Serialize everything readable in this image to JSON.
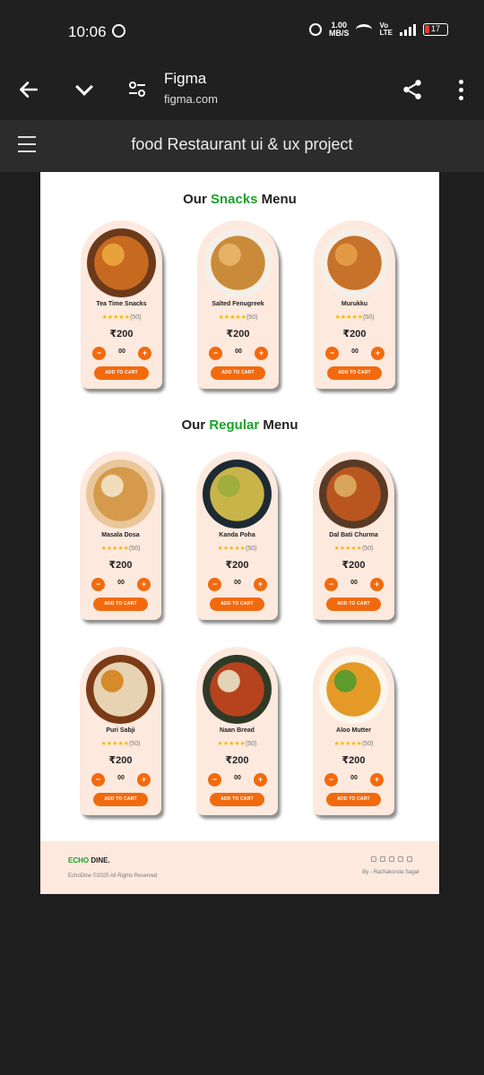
{
  "status_bar": {
    "time": "10:06",
    "speed_value": "1.00",
    "speed_unit": "MB/S",
    "volte_top": "Vo",
    "volte_bottom": "LTE",
    "battery": "17"
  },
  "browser": {
    "site_title": "Figma",
    "site_url": "figma.com"
  },
  "figma": {
    "title": "food Restaurant ui & ux project"
  },
  "sections": {
    "snacks": {
      "prefix": "Our ",
      "accent": "Snacks",
      "suffix": " Menu"
    },
    "regular": {
      "prefix": "Our ",
      "accent": "Regular",
      "suffix": " Menu"
    }
  },
  "items": [
    {
      "name": "Tea Time Snacks",
      "stars": "★★★★★",
      "count": "(50)",
      "price": "₹200",
      "qty": "00",
      "cart": "ADD TO CART",
      "minus": "−",
      "plus": "+",
      "colors": [
        "#6b3a1a",
        "#c76a1f",
        "#e9a23b"
      ]
    },
    {
      "name": "Salted Fenugreek",
      "stars": "★★★★★",
      "count": "(50)",
      "price": "₹200",
      "qty": "00",
      "cart": "ADD TO CART",
      "minus": "−",
      "plus": "+",
      "colors": [
        "#f5efe7",
        "#c98b3a",
        "#e7b266"
      ]
    },
    {
      "name": "Murukku",
      "stars": "★★★★★",
      "count": "(50)",
      "price": "₹200",
      "qty": "00",
      "cart": "ADD TO CART",
      "minus": "−",
      "plus": "+",
      "colors": [
        "#f6efe8",
        "#c6722a",
        "#e39a45"
      ]
    },
    {
      "name": "Masala Dosa",
      "stars": "★★★★★",
      "count": "(50)",
      "price": "₹200",
      "qty": "00",
      "cart": "ADD TO CART",
      "minus": "−",
      "plus": "+",
      "colors": [
        "#e9c79a",
        "#d59a4b",
        "#f1dcbc"
      ]
    },
    {
      "name": "Kanda Poha",
      "stars": "★★★★★",
      "count": "(50)",
      "price": "₹200",
      "qty": "00",
      "cart": "ADD TO CART",
      "minus": "−",
      "plus": "+",
      "colors": [
        "#1d2a33",
        "#c9b44a",
        "#9fae3c"
      ]
    },
    {
      "name": "Dal Bati Churma",
      "stars": "★★★★★",
      "count": "(50)",
      "price": "₹200",
      "qty": "00",
      "cart": "ADD TO CART",
      "minus": "−",
      "plus": "+",
      "colors": [
        "#5a3a26",
        "#b9561f",
        "#d9a55a"
      ]
    },
    {
      "name": "Puri Sabji",
      "stars": "★★★★★",
      "count": "(50)",
      "price": "₹200",
      "qty": "00",
      "cart": "ADD TO CART",
      "minus": "−",
      "plus": "+",
      "colors": [
        "#7a3b16",
        "#e7d2b2",
        "#d58a2c"
      ]
    },
    {
      "name": "Naan Bread",
      "stars": "★★★★★",
      "count": "(50)",
      "price": "₹200",
      "qty": "00",
      "cart": "ADD TO CART",
      "minus": "−",
      "plus": "+",
      "colors": [
        "#2f3a26",
        "#b6431e",
        "#e3d3b4"
      ]
    },
    {
      "name": "Aloo Mutter",
      "stars": "★★★★★",
      "count": "(50)",
      "price": "₹200",
      "qty": "00",
      "cart": "ADD TO CART",
      "minus": "−",
      "plus": "+",
      "colors": [
        "#fbf6ee",
        "#e59a27",
        "#5f9a2c"
      ]
    }
  ],
  "footer": {
    "brand_accent": "ECHO",
    "brand_rest": " DINE.",
    "copyright": "EchoDine ©2025 All Rights Reserved",
    "byline": "By - Rachakonda Sagar",
    "social_icons": [
      "instagram-icon",
      "linkedin-icon",
      "facebook-icon",
      "twitter-icon",
      "dribbble-icon"
    ]
  },
  "theme": {
    "accent_orange": "#f26a0e",
    "accent_green": "#1aa12a",
    "card_bg": "#fde9de",
    "star": "#f5b800"
  }
}
